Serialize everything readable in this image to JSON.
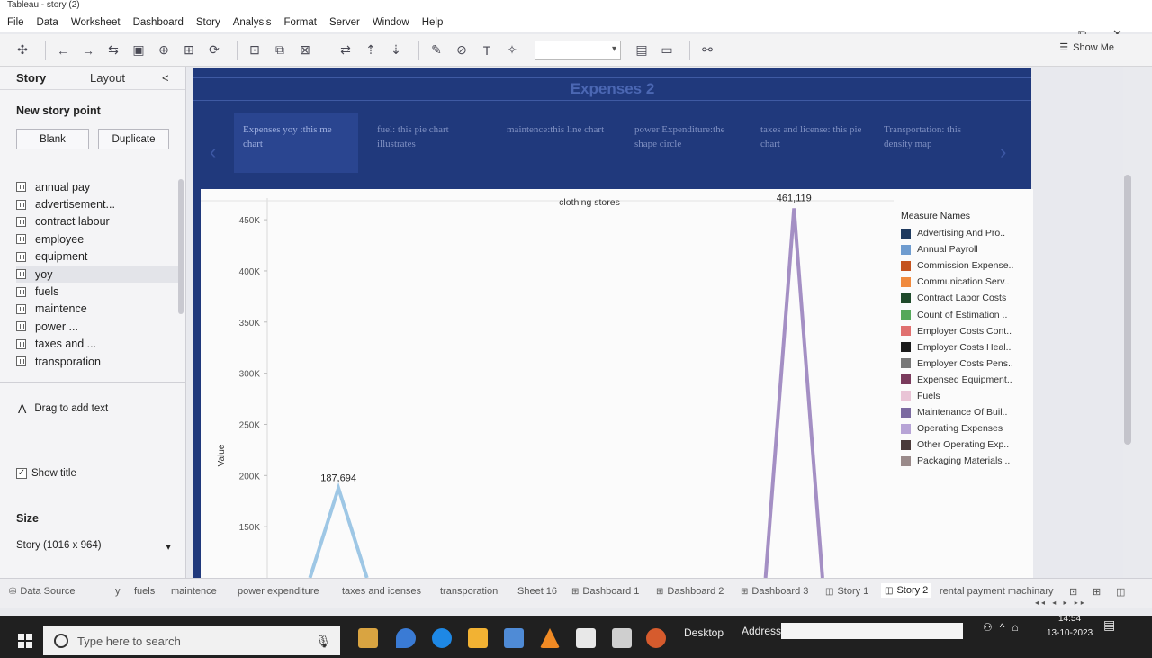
{
  "window": {
    "title": "Tableau - story (2)"
  },
  "menu": [
    "File",
    "Data",
    "Worksheet",
    "Dashboard",
    "Story",
    "Analysis",
    "Format",
    "Server",
    "Window",
    "Help"
  ],
  "toolbar": {
    "show_me": "Show Me"
  },
  "left_panel": {
    "tab_story": "Story",
    "tab_layout": "Layout",
    "collapse": "<",
    "new_story_point": "New story point",
    "blank_button": "Blank",
    "duplicate_button": "Duplicate",
    "sheets": [
      "annual pay",
      "advertisement...",
      "contract labour",
      "employee",
      "equipment",
      "yoy",
      "fuels",
      "maintence",
      "power ...",
      "taxes and ...",
      "transporation"
    ],
    "drag_text": "Drag to add text",
    "show_title": "Show title",
    "size_heading": "Size",
    "size_value": "Story (1016 x 964)"
  },
  "story": {
    "title": "Expenses 2",
    "points": [
      "Expenses yoy :this me chart",
      "fuel: this pie chart illustrates",
      "maintence:this line chart",
      "power Expenditure:the shape circle",
      "taxes and license: this pie chart",
      "Transportation: this density map"
    ]
  },
  "chart_data": {
    "type": "line",
    "title": "clothing stores",
    "ylabel": "Value",
    "ylim": [
      100000,
      480000
    ],
    "yticks": [
      150000,
      200000,
      250000,
      300000,
      350000,
      400000,
      450000
    ],
    "ytick_labels": [
      "150K",
      "200K",
      "250K",
      "300K",
      "350K",
      "400K",
      "450K"
    ],
    "annotations": [
      "187,694",
      "461,119"
    ],
    "series": [
      {
        "values": [
          null,
          100000,
          187694,
          100000,
          null,
          null,
          null,
          null,
          null,
          null,
          null,
          null,
          null,
          null,
          null,
          null,
          null,
          null,
          null,
          null,
          null,
          null
        ]
      },
      {
        "values": [
          null,
          null,
          null,
          null,
          null,
          null,
          null,
          null,
          null,
          null,
          null,
          null,
          null,
          null,
          null,
          null,
          null,
          100000,
          461119,
          100000,
          null,
          null
        ]
      }
    ],
    "series_colors": [
      "#9ec7e5",
      "#a48fc4"
    ],
    "legend_title": "Measure Names",
    "legend": [
      {
        "name": "Advertising And Pro..",
        "color": "#1f3a5f"
      },
      {
        "name": "Annual Payroll",
        "color": "#6f9ccf"
      },
      {
        "name": "Commission Expense..",
        "color": "#c4531f"
      },
      {
        "name": "Communication Serv..",
        "color": "#f08a3e"
      },
      {
        "name": "Contract Labor Costs",
        "color": "#1f4a2a"
      },
      {
        "name": "Count of Estimation ..",
        "color": "#55a85a"
      },
      {
        "name": "Employer Costs Cont..",
        "color": "#e0706f"
      },
      {
        "name": "Employer Costs Heal..",
        "color": "#1a1a1a"
      },
      {
        "name": "Employer Costs Pens..",
        "color": "#777777"
      },
      {
        "name": "Expensed Equipment..",
        "color": "#7a3a5c"
      },
      {
        "name": "Fuels",
        "color": "#e9c4d6"
      },
      {
        "name": "Maintenance Of Buil..",
        "color": "#7b6aa0"
      },
      {
        "name": "Operating Expenses",
        "color": "#b7a4d6"
      },
      {
        "name": "Other Operating Exp..",
        "color": "#4a3a3a"
      },
      {
        "name": "Packaging Materials ..",
        "color": "#9a8a8a"
      }
    ]
  },
  "bottom_tabs": [
    {
      "label": "Data Source",
      "kind": "source"
    },
    {
      "label": "y",
      "kind": "sheet"
    },
    {
      "label": "fuels",
      "kind": "sheet"
    },
    {
      "label": "maintence",
      "kind": "sheet"
    },
    {
      "label": "power expenditure",
      "kind": "sheet"
    },
    {
      "label": "taxes and icenses",
      "kind": "sheet"
    },
    {
      "label": "transporation",
      "kind": "sheet"
    },
    {
      "label": "Sheet 16",
      "kind": "sheet"
    },
    {
      "label": "Dashboard 1",
      "kind": "dashboard"
    },
    {
      "label": "Dashboard 2",
      "kind": "dashboard"
    },
    {
      "label": "Dashboard 3",
      "kind": "dashboard"
    },
    {
      "label": "Story 1",
      "kind": "story"
    },
    {
      "label": "Story 2",
      "kind": "story",
      "active": true
    },
    {
      "label": "rental payment machinary",
      "kind": "sheet"
    }
  ],
  "taskbar": {
    "search_placeholder": "Type here to search",
    "desktop": "Desktop",
    "address": "Address",
    "time": "14:54",
    "date": "13-10-2023"
  }
}
